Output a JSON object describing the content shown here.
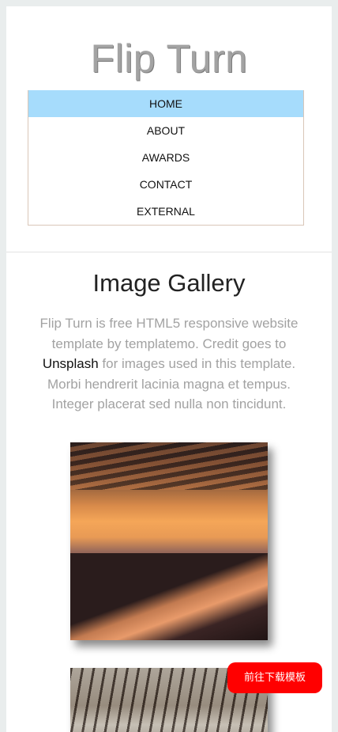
{
  "site": {
    "title": "Flip Turn"
  },
  "nav": {
    "items": [
      {
        "label": "HOME",
        "active": true
      },
      {
        "label": "ABOUT",
        "active": false
      },
      {
        "label": "AWARDS",
        "active": false
      },
      {
        "label": "CONTACT",
        "active": false
      },
      {
        "label": "EXTERNAL",
        "active": false
      }
    ]
  },
  "gallery": {
    "title": "Image Gallery",
    "intro_before": "Flip Turn is free HTML5 responsive website template by templatemo. Credit goes to ",
    "intro_link": "Unsplash",
    "intro_after": " for images used in this template. Morbi hendrerit lacinia magna et tempus. Integer placerat sed nulla non tincidunt."
  },
  "download_button": {
    "label": "前往下载模板",
    "color": "#ff0000"
  },
  "colors": {
    "nav_active_bg": "#a6dcfc",
    "title_text": "#a3a3a3",
    "body_text": "#a2a2a2"
  }
}
